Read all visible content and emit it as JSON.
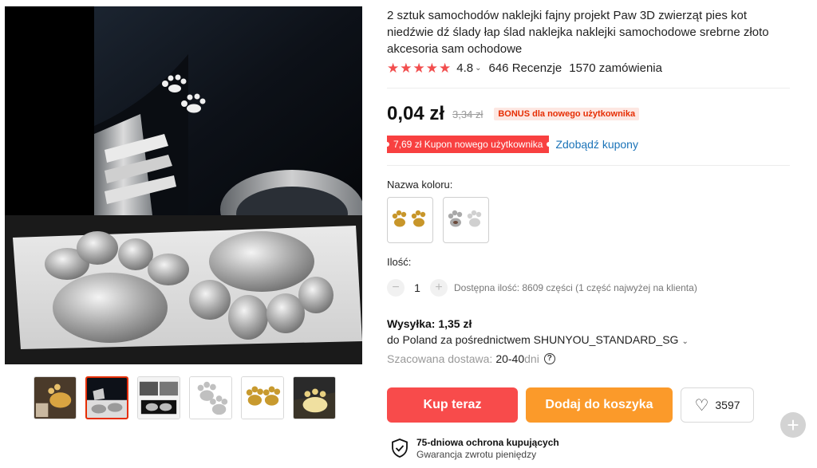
{
  "product": {
    "title": "2 sztuk samochodów naklejki fajny projekt Paw 3D zwierząt pies kot niedźwie dź ślady łap ślad naklejka naklejki samochodowe srebrne złoto akcesoria sam ochodowe",
    "rating": "4.8",
    "reviews": "646 Recenzje",
    "orders": "1570 zamówienia",
    "star_color": "#f24e4e"
  },
  "price": {
    "current": "0,04 zł",
    "original": "3,34 zł",
    "bonus_badge": "BONUS dla nowego użytkownika"
  },
  "coupon": {
    "label": "7,69 zł Kupon nowego użytkownika",
    "link": "Zdobądź kupony"
  },
  "color": {
    "label": "Nazwa koloru:",
    "options": [
      "gold",
      "silver"
    ]
  },
  "quantity": {
    "label": "Ilość:",
    "value": "1",
    "minus": "−",
    "plus": "+",
    "stock": "Dostępna ilość: 8609 części (1 część najwyżej na klienta)"
  },
  "shipping": {
    "title": "Wysyłka: 1,35 zł",
    "via": "do Poland za pośrednictwem SHUNYOU_STANDARD_SG",
    "delivery_label": "Szacowana dostawa:",
    "delivery_days": "20-40",
    "delivery_unit": "dni"
  },
  "actions": {
    "buy_now": "Kup teraz",
    "add_to_cart": "Dodaj do koszyka",
    "wishlist_count": "3597",
    "buy_color": "#f84b4b",
    "cart_color": "#fb9a2a"
  },
  "protection": {
    "title": "75-dniowa ochrona kupujących",
    "subtitle": "Gwarancja zwrotu pieniędzy"
  },
  "gallery": {
    "thumbnail_count": 6,
    "active_index": 1
  }
}
